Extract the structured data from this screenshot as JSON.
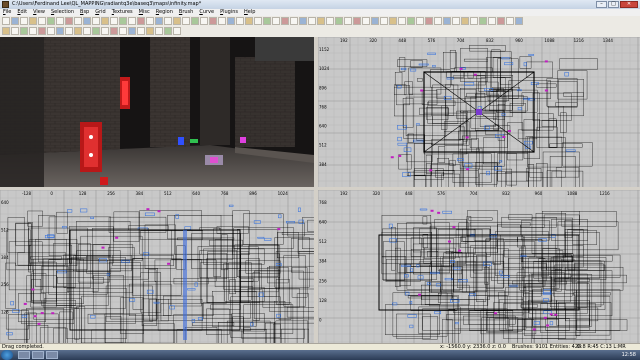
{
  "window": {
    "title": "C:\\Users\\Ferdinand Lee\\QL_MAPPING\\radiantq3e\\baseq3\\maps\\infinity.map*"
  },
  "menu": [
    "File",
    "Edit",
    "View",
    "Selection",
    "Bsp",
    "Grid",
    "Textures",
    "Misc",
    "Region",
    "Brush",
    "Curve",
    "Plugins",
    "Help"
  ],
  "status": {
    "message": "Drag completed.",
    "coords": "x: -1560.0  y: 2336.0  z: 0.0",
    "counts": "Brushes: 9101 Entities: 428",
    "grid": "G:8 R:45 C:13 L:MR"
  },
  "taskbar": {
    "clock": "12:58"
  },
  "viewports": {
    "top": {
      "xticks": [
        "192",
        "320",
        "448",
        "576",
        "704",
        "832",
        "960",
        "1088",
        "1216",
        "1344"
      ],
      "yticks": [
        "1152",
        "1024",
        "896",
        "768",
        "640",
        "512",
        "384"
      ]
    },
    "side": {
      "xticks": [
        "-128",
        "0",
        "128",
        "256",
        "384",
        "512",
        "640",
        "768",
        "896",
        "1024"
      ],
      "yticks": [
        "640",
        "512",
        "384",
        "256",
        "128"
      ]
    },
    "front": {
      "xticks": [
        "192",
        "320",
        "448",
        "576",
        "704",
        "832",
        "960",
        "1088",
        "1216"
      ],
      "yticks": [
        "768",
        "640",
        "512",
        "384",
        "256",
        "128",
        "0"
      ]
    }
  },
  "colors": {
    "grid_bg": "#c8c8c8",
    "grid_line": "#b4b4b4",
    "brush": "#000000",
    "accent_blue": "#2a6be0",
    "accent_magenta": "#c020c0"
  }
}
